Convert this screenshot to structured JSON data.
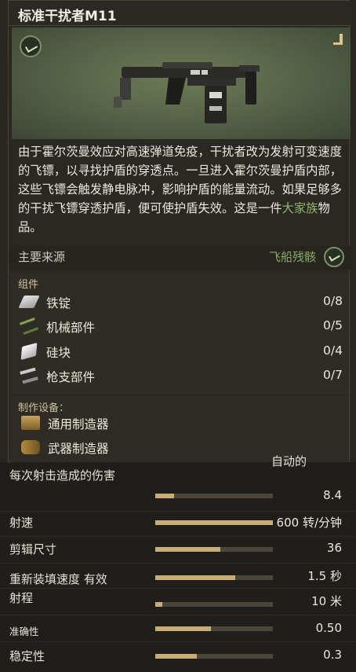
{
  "item": {
    "title": "标准干扰者M11",
    "description_pre": "由于霍尔茨曼效应对高速弹道免疫，干扰者改为发射可变速度的飞镖，以寻找护盾的穿透点。一旦进入霍尔茨曼护盾内部，这些飞镖会触发静电脉冲，影响护盾的能量流动。如果足够多的干扰飞镖穿透护盾，便可使护盾失效。这是一件",
    "description_highlight": "大家族",
    "description_post": "物品。",
    "highlight_color": "#8fb96a"
  },
  "source": {
    "label": "主要来源",
    "value": "飞船残骸",
    "icon": "derelict-ship-icon"
  },
  "components": {
    "label": "组件",
    "items": [
      {
        "name": "铁锭",
        "count": "0/8",
        "icon": "iron-ingot-icon"
      },
      {
        "name": "机械部件",
        "count": "0/5",
        "icon": "mechanical-parts-icon"
      },
      {
        "name": "硅块",
        "count": "0/4",
        "icon": "silicon-block-icon"
      },
      {
        "name": "枪支部件",
        "count": "0/7",
        "icon": "gun-parts-icon"
      }
    ]
  },
  "devices": {
    "label": "制作设备：",
    "items": [
      {
        "name": "通用制造器",
        "icon": "universal-fabricator-icon"
      },
      {
        "name": "武器制造器",
        "icon": "weapon-fabricator-icon"
      }
    ]
  },
  "stats": {
    "partial_text": "自动的",
    "items": [
      {
        "label": "每次射击造成的伤害",
        "value": "8.4",
        "fill": 0.16
      },
      {
        "label": "射速",
        "value": "600 转/分钟",
        "fill": 1.0
      },
      {
        "label": "剪辑尺寸",
        "value": "36",
        "fill": 0.55
      },
      {
        "label": "重新装填速度 有效",
        "value": "1.5 秒",
        "fill": 0.68
      },
      {
        "label": "射程",
        "value": "10 米",
        "fill": 0.06
      },
      {
        "label": "准确性",
        "value": "0.50",
        "fill": 0.47
      },
      {
        "label": "稳定性",
        "value": "0.3",
        "fill": 0.35
      }
    ]
  }
}
